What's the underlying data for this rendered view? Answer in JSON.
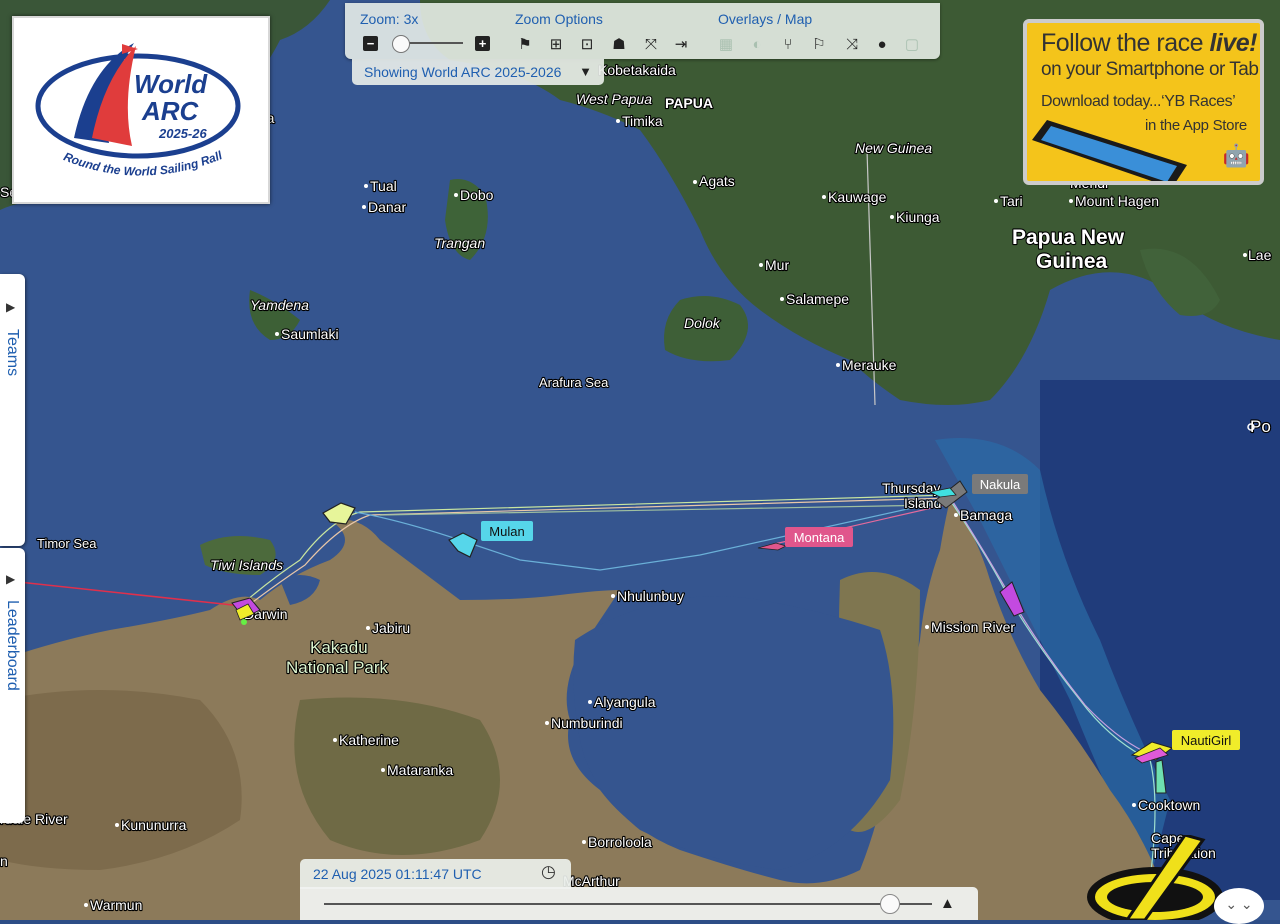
{
  "toolbar": {
    "zoom_label": "Zoom: 3x",
    "zoom_options_label": "Zoom Options",
    "overlays_label": "Overlays / Map",
    "zoom_out": "−",
    "zoom_in": "+",
    "zoom_level": 3,
    "icons": [
      "flag-icon",
      "zoom-in-box-icon",
      "zoom-dots-icon",
      "group-icon",
      "fullscreen-icon",
      "exit-icon",
      "grid-overlay-icon",
      "day-night-icon",
      "wind-icon",
      "flag-wind-icon",
      "shuffle-icon",
      "globe-icon",
      "square-icon"
    ]
  },
  "showing": {
    "label": "Showing World ARC 2025-2026",
    "arrow": "▼"
  },
  "logo": {
    "line1": "World",
    "line2": "ARC",
    "years": "2025-26",
    "tagline": "Round the World Sailing Rally"
  },
  "ad": {
    "headline_prefix": "Follow the race ",
    "headline_live": "live!",
    "line2": "on your Smartphone or Tab",
    "line3": "Download today...‘YB Races’",
    "line4": "in the App Store",
    "store_icons": "🤖 "
  },
  "side_tabs": {
    "teams": "Teams",
    "leaderboard": "Leaderboard",
    "arrow": "▶"
  },
  "timebar": {
    "datetime": "22 Aug 2025 01:11:47 UTC",
    "clock": "◷",
    "play": "▲",
    "position": 0.93
  },
  "expand": "⌄ ⌄",
  "map": {
    "places": {
      "timika": "Timika",
      "kobetakaida": "Kobetakaida",
      "west_papua": "West Papua",
      "papua": "PAPUA",
      "agats": "Agats",
      "new_guinea": "New Guinea",
      "kauwage": "Kauwage",
      "kiunga": "Kiunga",
      "tari": "Tari",
      "mount_hagen": "Mount Hagen",
      "mendi": "Mendi",
      "png1": "Papua New",
      "png2": "Guinea",
      "lae": "Lae",
      "port": "Po",
      "tual": "Tual",
      "dobo": "Dobo",
      "danar": "Danar",
      "trangan": "Trangan",
      "yamdena": "Yamdena",
      "saumlaki": "Saumlaki",
      "mur": "Mur",
      "salamepe": "Salamepe",
      "dolok": "Dolok",
      "merauke": "Merauke",
      "arafura_sea": "Arafura Sea",
      "timor_sea": "Timor Sea",
      "tiwi_islands": "Tiwi Islands",
      "darwin": "Darwin",
      "kakadu1": "Kakadu",
      "kakadu2": "National Park",
      "jabiru": "Jabiru",
      "nhulunbuy": "Nhulunbuy",
      "thursday1": "Thursday",
      "thursday2": "Island",
      "bamaga": "Bamaga",
      "mission_river": "Mission River",
      "alyangula": "Alyangula",
      "numburindi": "Numburindi",
      "katherine": "Katherine",
      "mataranka": "Mataranka",
      "kununurra": "Kununurra",
      "borroloola": "Borroloola",
      "mcarthur": "McArthur",
      "cooktown": "Cooktown",
      "cape1": "Cape",
      "cape2": "Tribulation",
      "warmun": "Warmun",
      "ord_river": "rdale River",
      "ra": "ra",
      "sea": "Sea",
      "n": "n"
    },
    "boats": {
      "mulan": "Mulan",
      "montana": "Montana",
      "nakula": "Nakula",
      "nautigirl": "NautiGirl"
    },
    "colors": {
      "mulan": "#56d6ea",
      "montana": "#e0568c",
      "nakula": "#7a7a7a",
      "nautigirl": "#f0ec2a"
    }
  }
}
